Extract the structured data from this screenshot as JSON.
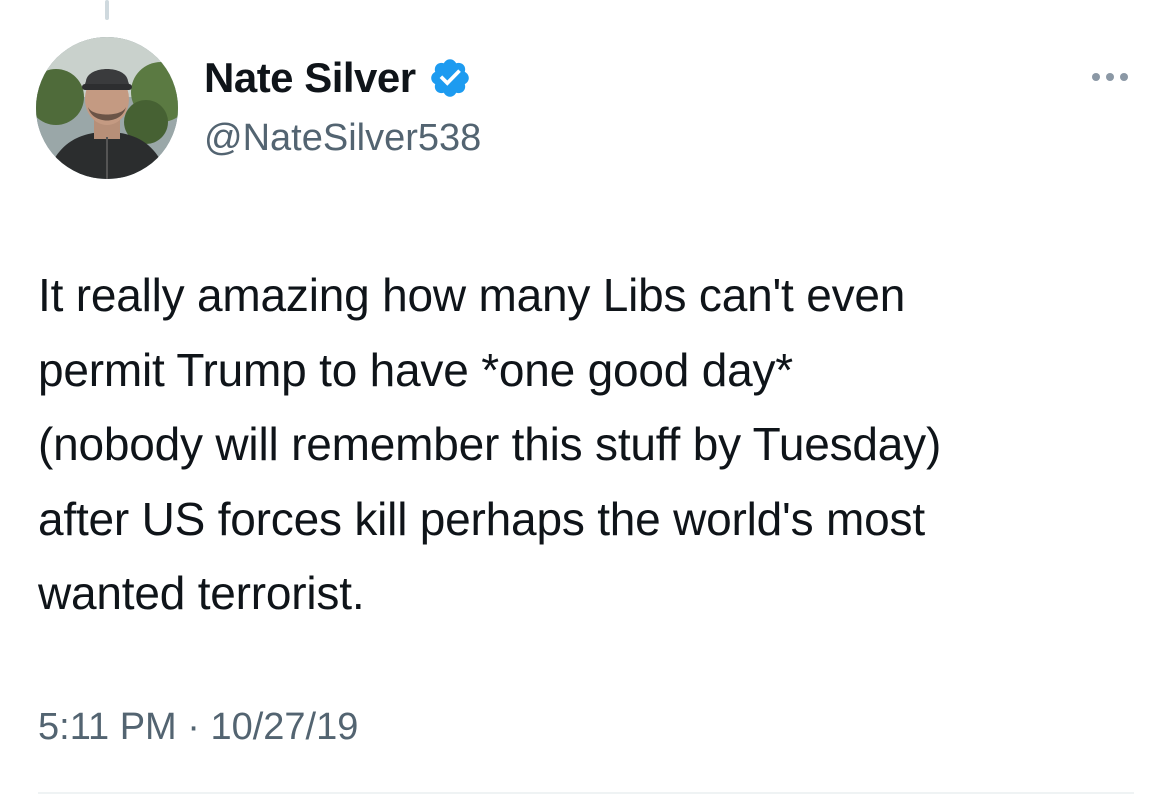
{
  "tweet": {
    "author": {
      "display_name": "Nate Silver",
      "handle": "@NateSilver538",
      "verified_icon": "verified-badge-icon",
      "verified_color": "#1d9bf0"
    },
    "text_lines": [
      "It really amazing how many Libs can't even",
      "permit Trump to have *one good day*",
      "(nobody will remember this stuff by Tuesday)",
      "after US forces kill perhaps the world's most",
      "wanted terrorist."
    ],
    "timestamp": "5:11 PM · 10/27/19",
    "more_icon": "more-horizontal-icon"
  },
  "colors": {
    "text_primary": "#0f1419",
    "text_secondary": "#536471",
    "divider": "#eff3f4"
  }
}
